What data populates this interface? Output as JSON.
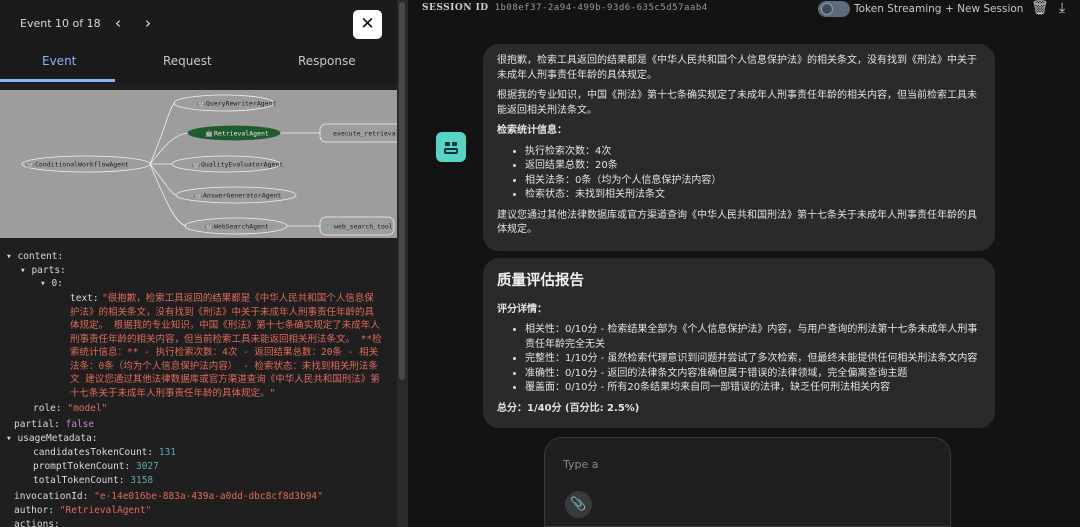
{
  "event_panel": {
    "counter": "Event 10 of 18",
    "prev_icon": "chevron-left",
    "next_icon": "chevron-right",
    "close_icon": "close",
    "tabs": [
      "Event",
      "Request",
      "Response"
    ],
    "active_tab": "Event"
  },
  "graph": {
    "nodes": {
      "root": "ConditionalWorkflowAgent",
      "n1": "QueryRewriterAgent",
      "n2": "RetrievalAgent",
      "n3": "QualityEvaluatorAgent",
      "n4": "AnswerGeneratorAgent",
      "n5": "WebSearchAgent",
      "t1": "execute_retrieval",
      "t2": "web_search_tool"
    },
    "active_node_color": "#1e5b2e"
  },
  "tree": {
    "content_key": "content:",
    "parts_key": "parts:",
    "index_key": "0:",
    "text_key": "text:",
    "text_value": "\"很抱歉，检索工具返回的结果都是《中华人民共和国个人信息保护法》的相关条文，没有找到《刑法》中关于未成年人刑事责任年龄的具体规定。  根据我的专业知识，中国《刑法》第十七条确实规定了未成年人刑事责任年龄的相关内容，但当前检索工具未能返回相关刑法条文。  **检索统计信息：** - 执行检索次数：4次 - 返回结果总数：20条 - 相关法条：0条（均为个人信息保护法内容） - 检索状态：未找到相关刑法条文  建议您通过其他法律数据库或官方渠道查询《中华人民共和国刑法》第十七条关于未成年人刑事责任年龄的具体规定。\"",
    "role_key": "role:",
    "role_value": "\"model\"",
    "partial_key": "partial:",
    "partial_value": "false",
    "usage_key": "usageMetadata:",
    "cand_key": "candidatesTokenCount:",
    "cand_value": "131",
    "prompt_key": "promptTokenCount:",
    "prompt_value": "3027",
    "total_key": "totalTokenCount:",
    "total_value": "3158",
    "inv_key": "invocationId:",
    "inv_value": "\"e-14e016be-883a-439a-a0dd-dbc8cf8d3b94\"",
    "author_key": "author:",
    "author_value": "\"RetrievalAgent\"",
    "actions_key": "actions:"
  },
  "header": {
    "session_label": "SESSION ID",
    "session_id": "1b08ef37-2a94-499b-93d6-635c5d57aab4",
    "token_streaming": "Token Streaming",
    "new_session": "+ New Session"
  },
  "message1": {
    "p1": "很抱歉，检索工具返回的结果都是《中华人民共和国个人信息保护法》的相关条文，没有找到《刑法》中关于未成年人刑事责任年龄的具体规定。",
    "p2": "根据我的专业知识，中国《刑法》第十七条确实规定了未成年人刑事责任年龄的相关内容，但当前检索工具未能返回相关刑法条文。",
    "stats_title": "检索统计信息：",
    "bullets": [
      "执行检索次数：4次",
      "返回结果总数：20条",
      "相关法条：0条（均为个人信息保护法内容）",
      "检索状态：未找到相关刑法条文"
    ],
    "p3": "建议您通过其他法律数据库或官方渠道查询《中华人民共和国刑法》第十七条关于未成年人刑事责任年龄的具体规定。"
  },
  "message2": {
    "title": "质量评估报告",
    "detail_title": "评分详情：",
    "bullets": [
      "相关性：0/10分 - 检索结果全部为《个人信息保护法》内容，与用户查询的刑法第十七条未成年人刑事责任年龄完全无关",
      "完整性：1/10分 - 虽然检索代理意识到问题并尝试了多次检索，但最终未能提供任何相关刑法条文内容",
      "准确性：0/10分 - 返回的法律条文内容准确但属于错误的法律领域，完全偏离查询主题",
      "覆盖面：0/10分 - 所有20条结果均来自同一部错误的法律，缺乏任何刑法相关内容"
    ],
    "total": "总分：1/40分 (百分比: 2.5%)"
  },
  "composer": {
    "placeholder": "Type a"
  }
}
